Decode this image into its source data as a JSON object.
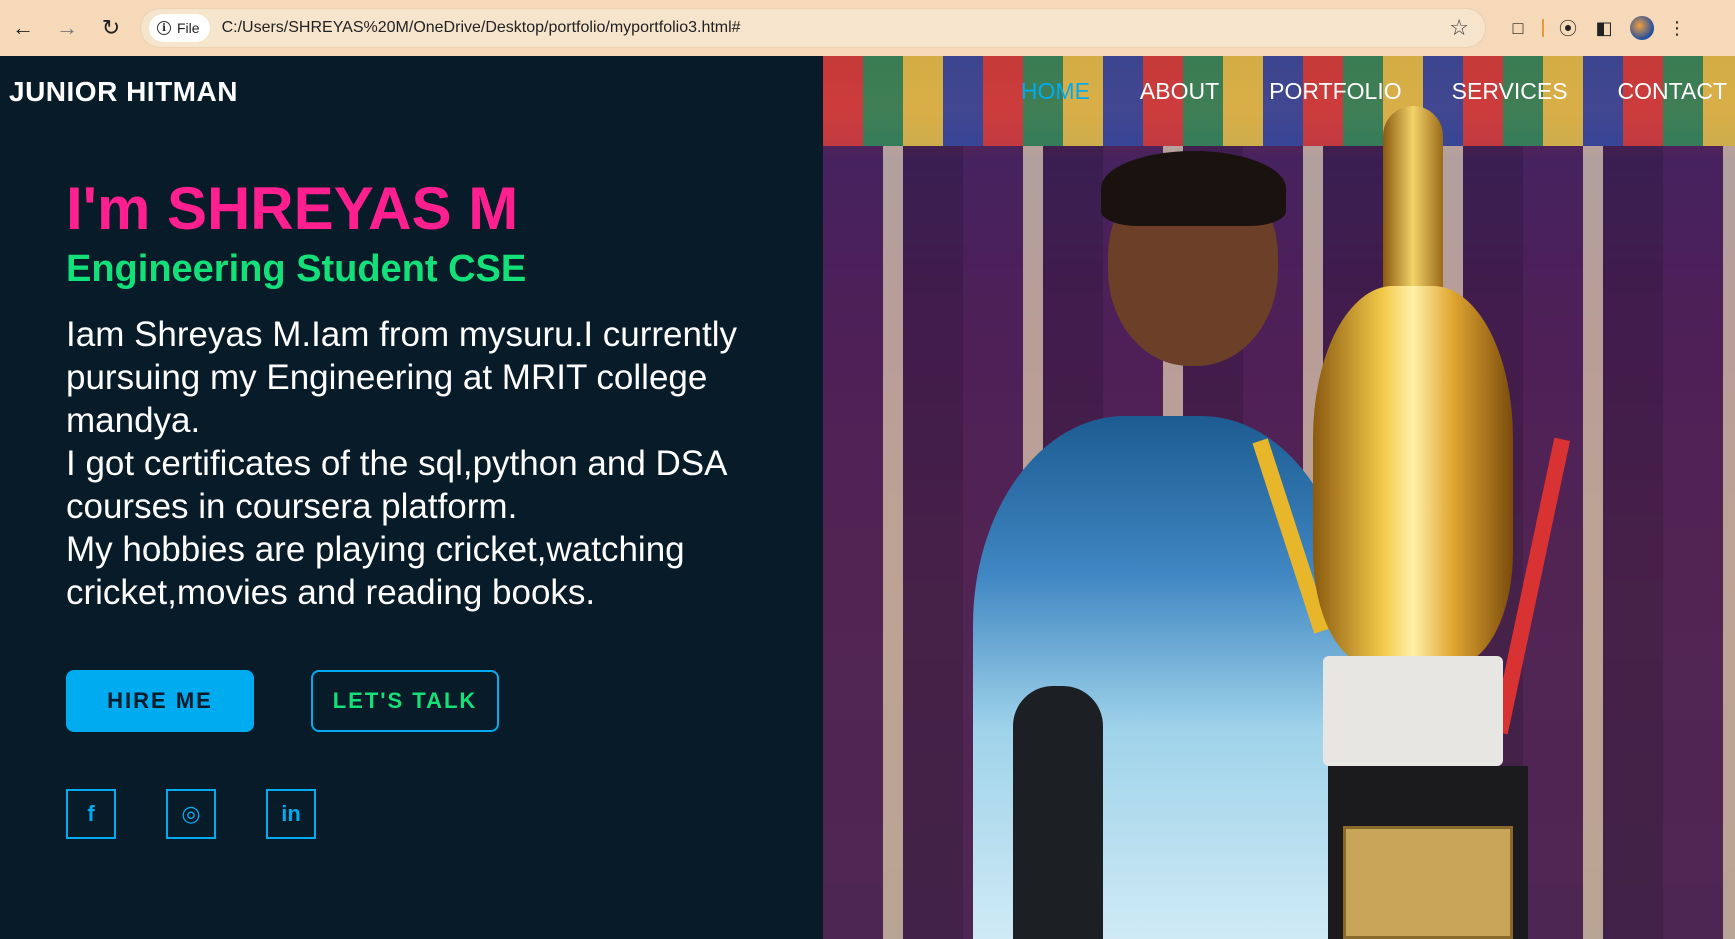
{
  "browser": {
    "site_chip": "File",
    "url": "C:/Users/SHREYAS%20M/OneDrive/Desktop/portfolio/myportfolio3.html#",
    "icons": [
      "back-icon",
      "forward-icon",
      "reload-icon",
      "info-icon",
      "star-icon",
      "extensions-icon",
      "performance-icon",
      "sidebar-icon",
      "profile-icon",
      "menu-icon"
    ]
  },
  "header": {
    "logo": "JUNIOR HITMAN",
    "nav": [
      {
        "label": "HOME",
        "active": true
      },
      {
        "label": "ABOUT"
      },
      {
        "label": "PORTFOLIO"
      },
      {
        "label": "SERVICES"
      },
      {
        "label": "CONTACT"
      }
    ]
  },
  "hero": {
    "title": "I'm SHREYAS M",
    "subtitle": "Engineering Student CSE",
    "bio_lines": [
      "Iam Shreyas M.Iam from mysuru.I currently pursuing my Engineering at MRIT college mandya.",
      "I got certificates of the sql,python and DSA courses in coursera platform.",
      "My hobbies are playing cricket,watching cricket,movies and reading books."
    ],
    "buttons": {
      "hire": "HIRE ME",
      "talk": "LET'S TALK"
    },
    "socials": [
      {
        "icon": "facebook-icon",
        "glyph": "f"
      },
      {
        "icon": "instagram-icon",
        "glyph": "◎"
      },
      {
        "icon": "linkedin-icon",
        "glyph": "in"
      }
    ]
  },
  "colors": {
    "background": "#081b29",
    "accent": "#00abf0",
    "title": "#ff1f8e",
    "subtitle": "#14e07a",
    "chrome": "#f5d9b8"
  }
}
